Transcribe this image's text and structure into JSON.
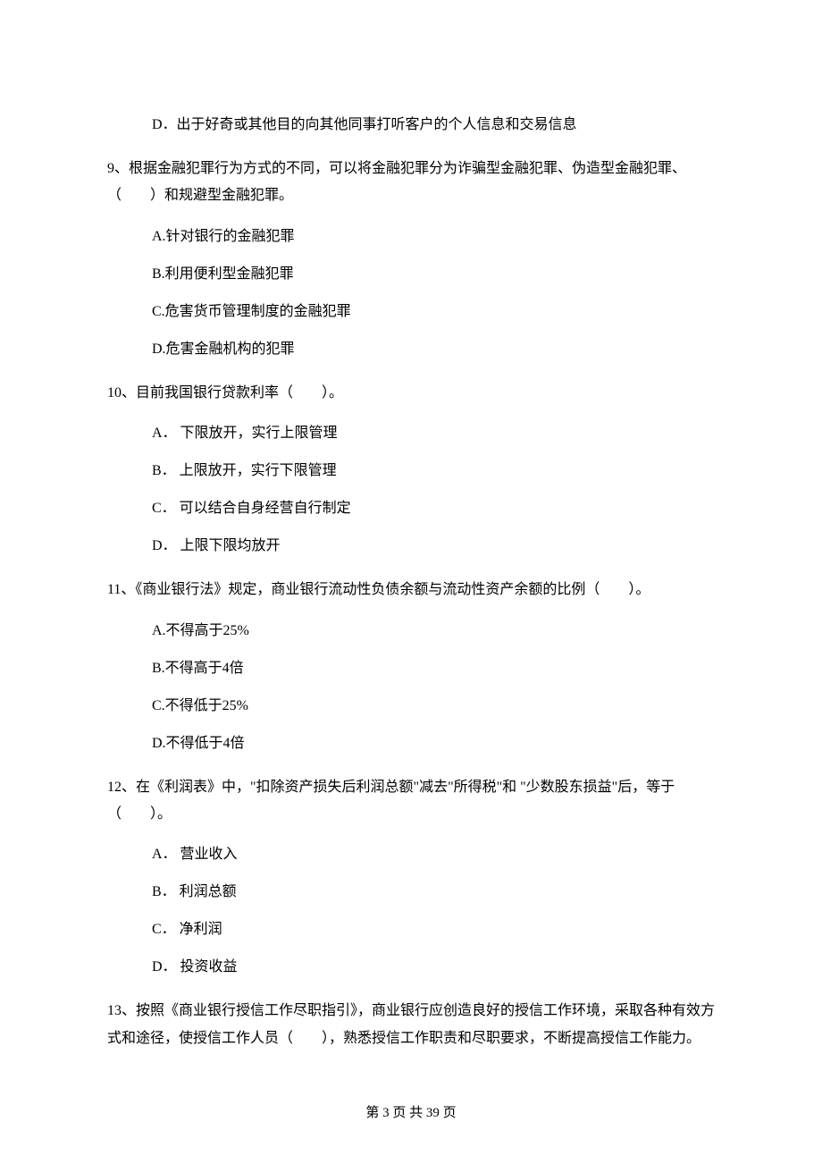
{
  "q8_option_d": "D．出于好奇或其他目的向其他同事打听客户的个人信息和交易信息",
  "q9_text": "9、根据金融犯罪行为方式的不同，可以将金融犯罪分为诈骗型金融犯罪、伪造型金融犯罪、（　　）和规避型金融犯罪。",
  "q9_a": "A.针对银行的金融犯罪",
  "q9_b": "B.利用便利型金融犯罪",
  "q9_c": "C.危害货币管理制度的金融犯罪",
  "q9_d": "D.危害金融机构的犯罪",
  "q10_text": "10、目前我国银行贷款利率（　　）。",
  "q10_a": "A． 下限放开，实行上限管理",
  "q10_b": "B． 上限放开，实行下限管理",
  "q10_c": "C． 可以结合自身经营自行制定",
  "q10_d": "D． 上限下限均放开",
  "q11_text": "11、《商业银行法》规定，商业银行流动性负债余额与流动性资产余额的比例（　　）。",
  "q11_a": "A.不得高于25%",
  "q11_b": "B.不得高于4倍",
  "q11_c": "C.不得低于25%",
  "q11_d": "D.不得低于4倍",
  "q12_text": "12、在《利润表》中，\"扣除资产损失后利润总额\"减去\"所得税\"和 \"少数股东损益\"后，等于（　　）。",
  "q12_a": "A． 营业收入",
  "q12_b": "B． 利润总额",
  "q12_c": "C． 净利润",
  "q12_d": "D． 投资收益",
  "q13_text": "13、按照《商业银行授信工作尽职指引》，商业银行应创造良好的授信工作环境，采取各种有效方式和途径，使授信工作人员（　　），熟悉授信工作职责和尽职要求，不断提高授信工作能力。",
  "footer": "第 3 页 共 39 页"
}
